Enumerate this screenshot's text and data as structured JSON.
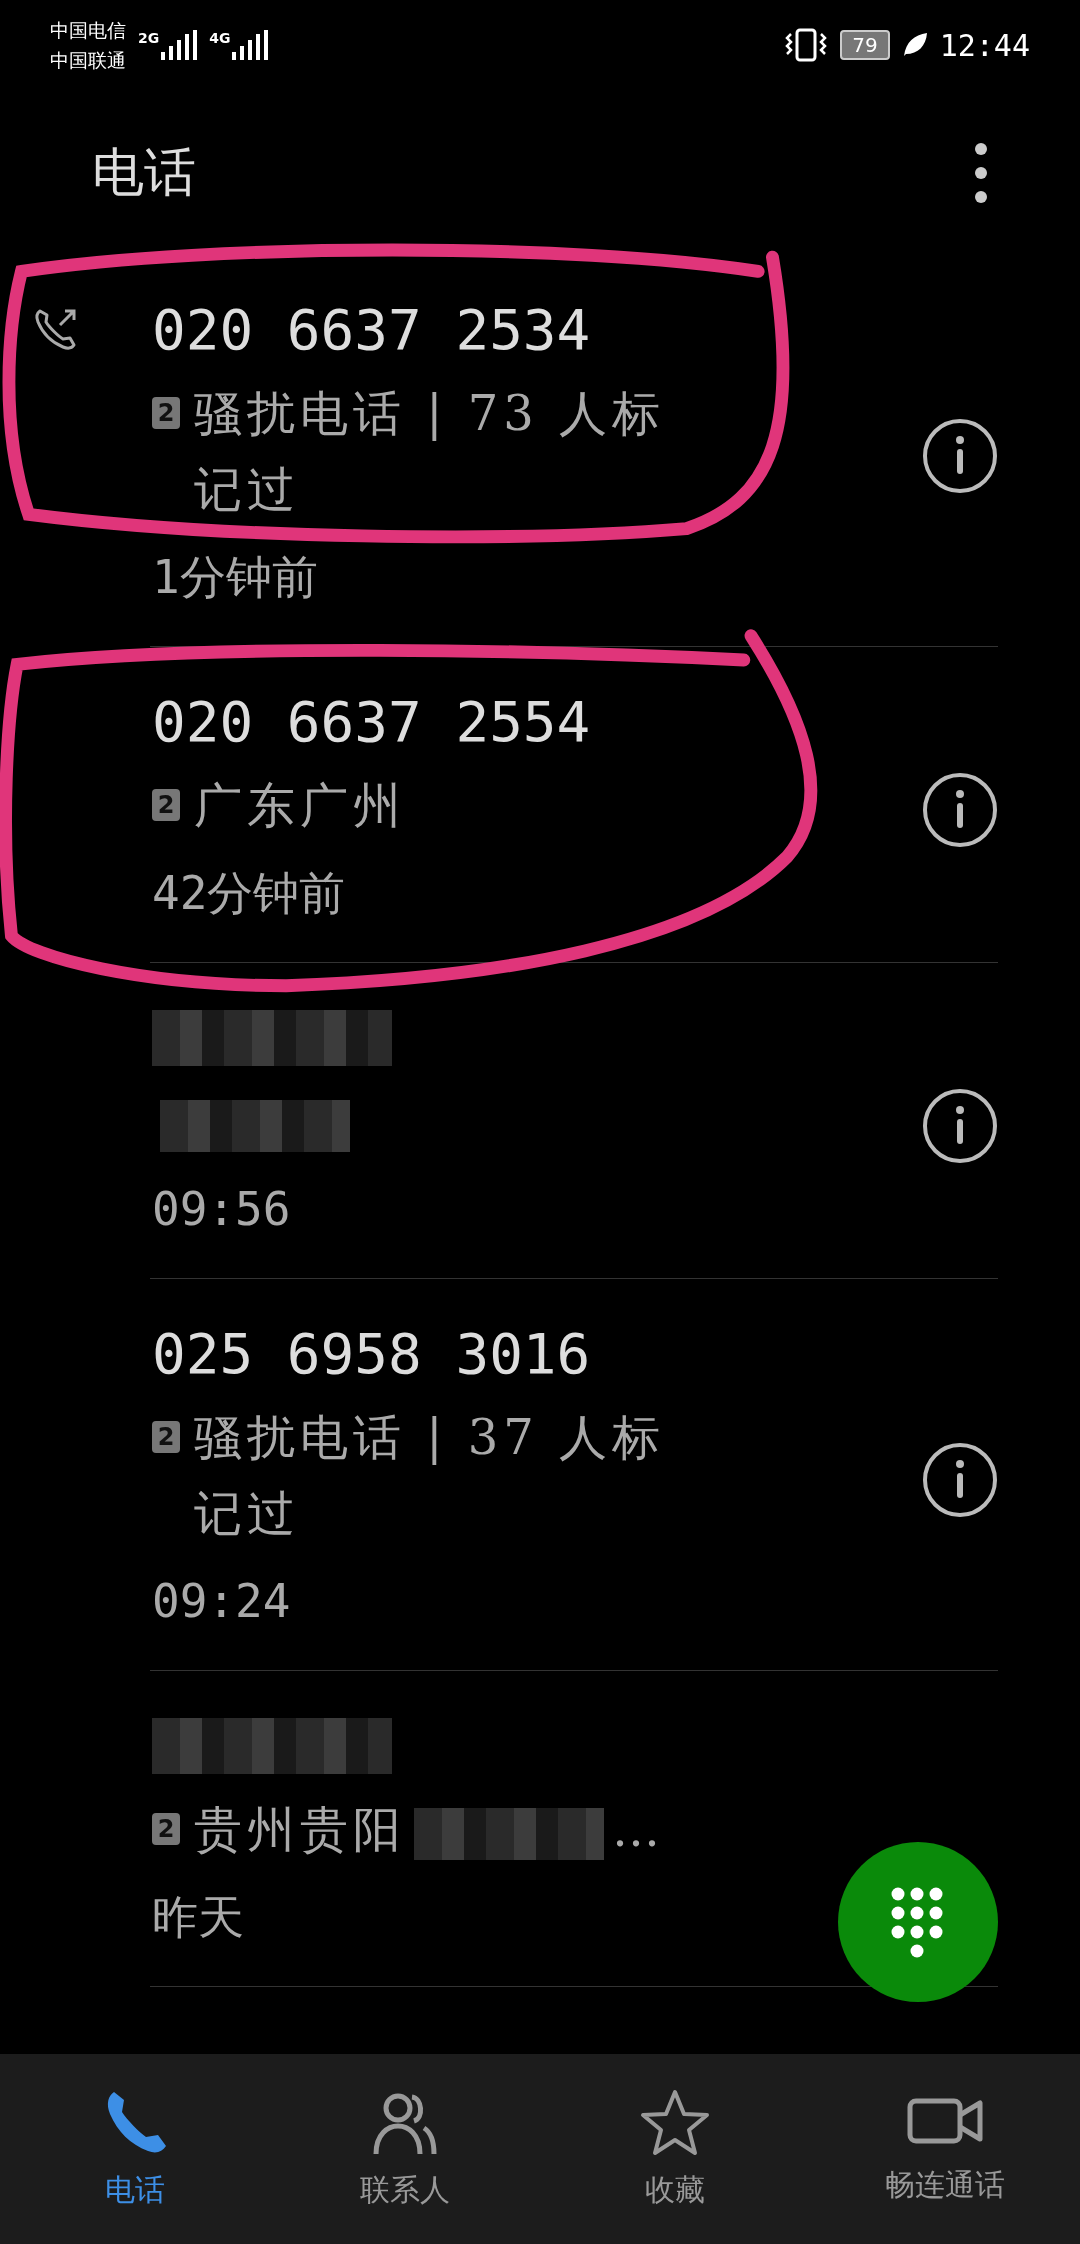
{
  "status_bar": {
    "carriers": [
      "中国电信",
      "中国联通"
    ],
    "networks": [
      "2G",
      "4G"
    ],
    "battery": "79",
    "time": "12:44"
  },
  "title": "电话",
  "calls": [
    {
      "kind": "number",
      "number": "020 6637 2534",
      "outgoing": true,
      "sim": "2",
      "detail": [
        {
          "kind": "text",
          "text": "骚扰电话 | 73 人标记过"
        }
      ],
      "time": "1分钟前"
    },
    {
      "kind": "number",
      "number": "020 6637 2554",
      "outgoing": false,
      "sim": "2",
      "detail": [
        {
          "kind": "text",
          "text": "广东广州"
        }
      ],
      "time": "42分钟前"
    },
    {
      "kind": "redacted",
      "outgoing": false,
      "detail": [
        {
          "kind": "redacted"
        }
      ],
      "time": "09:56"
    },
    {
      "kind": "number",
      "number": "025 6958 3016",
      "outgoing": false,
      "sim": "2",
      "detail": [
        {
          "kind": "text",
          "text": "骚扰电话 | 37 人标记过"
        }
      ],
      "time": "09:24"
    },
    {
      "kind": "redacted",
      "outgoing": false,
      "sim": "2",
      "detail": [
        {
          "kind": "text",
          "text": "贵州贵阳"
        },
        {
          "kind": "redacted"
        },
        {
          "kind": "text",
          "text": "…"
        }
      ],
      "time": "昨天",
      "info_hidden": true
    }
  ],
  "annotation_marks": [
    {
      "color": "#e0357a"
    },
    {
      "color": "#e0357a"
    }
  ],
  "nav": [
    {
      "label": "电话",
      "selected": true
    },
    {
      "label": "联系人",
      "selected": false
    },
    {
      "label": "收藏",
      "selected": false
    },
    {
      "label": "畅连通话",
      "selected": false
    }
  ]
}
